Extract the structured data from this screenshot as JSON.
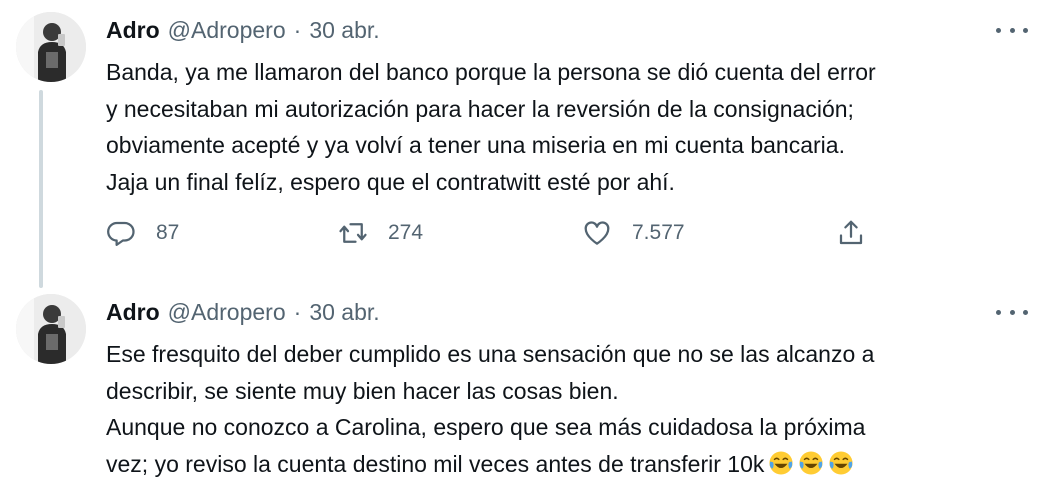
{
  "tweets": [
    {
      "name": "Adro",
      "handle": "@Adropero",
      "separator": "·",
      "date": "30 abr.",
      "lines": [
        "Banda, ya me llamaron del banco porque la persona se dió cuenta del error",
        "y necesitaban mi autorización para hacer la reversión de la consignación;",
        "obviamente acepté y ya volví a tener una miseria en mi cuenta bancaria.",
        "Jaja un final felíz, espero que el contratwitt esté por ahí."
      ],
      "replies": "87",
      "retweets": "274",
      "likes": "7.577"
    },
    {
      "name": "Adro",
      "handle": "@Adropero",
      "separator": "·",
      "date": "30 abr.",
      "lines": [
        "Ese fresquito del deber cumplido es una sensación que no se las alcanzo a",
        "describir, se siente muy bien hacer las cosas bien.",
        "Aunque no conozco a Carolina, espero que sea más cuidadosa la próxima",
        "vez; yo reviso la cuenta destino mil veces antes de transferir 10k"
      ],
      "emojis": [
        "face-with-tears-of-joy",
        "face-with-tears-of-joy",
        "face-with-tears-of-joy"
      ]
    }
  ],
  "colors": {
    "text": "#0f1419",
    "secondary": "#536471",
    "thread_line": "#cfd9de",
    "emoji_face": "#ffcc33",
    "emoji_tears": "#4fa3e8"
  }
}
